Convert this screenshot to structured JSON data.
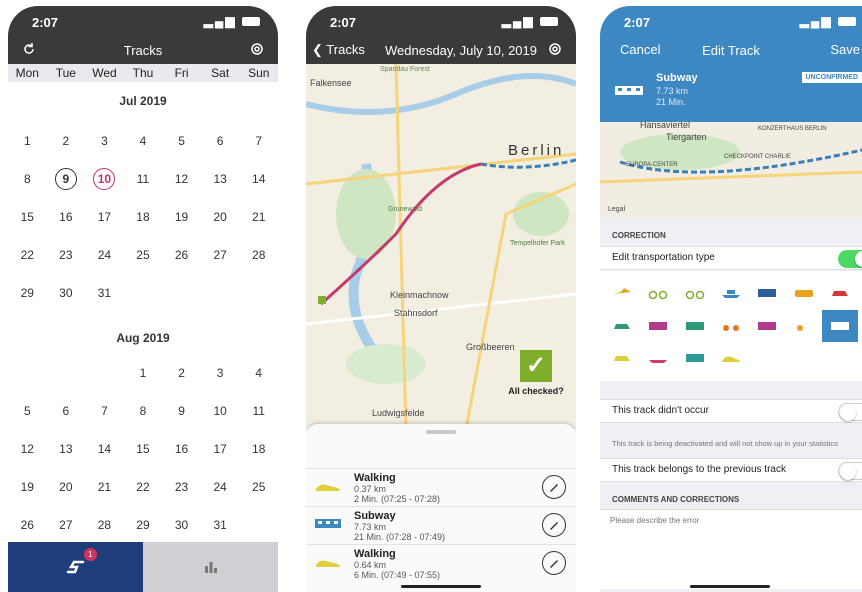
{
  "status": {
    "time": "2:07"
  },
  "screen1": {
    "title": "Tracks",
    "weekdays": [
      "Mon",
      "Tue",
      "Wed",
      "Thu",
      "Fri",
      "Sat",
      "Sun"
    ],
    "months": [
      {
        "label": "Jul 2019",
        "days": [
          "1",
          "2",
          "3",
          "4",
          "5",
          "6",
          "7",
          "8",
          "9",
          "10",
          "11",
          "12",
          "13",
          "14",
          "15",
          "16",
          "17",
          "18",
          "19",
          "20",
          "21",
          "22",
          "23",
          "24",
          "25",
          "26",
          "27",
          "28",
          "29",
          "30",
          "31"
        ],
        "offset": 0
      },
      {
        "label": "Aug 2019",
        "days": [
          "1",
          "2",
          "3",
          "4",
          "5",
          "6",
          "7",
          "8",
          "9",
          "10",
          "11",
          "12",
          "13",
          "14",
          "15",
          "16",
          "17",
          "18",
          "19",
          "20",
          "21",
          "22",
          "23",
          "24",
          "25",
          "26",
          "27",
          "28",
          "29",
          "30",
          "31"
        ],
        "offset": 3
      }
    ],
    "selected_day": "9",
    "today_day": "10",
    "badge": "1"
  },
  "screen2": {
    "back_label": "Tracks",
    "title": "Wednesday, July 10, 2019",
    "map_labels": {
      "falkensee": "Falkensee",
      "berlin": "Berlin",
      "tempelhof": "Tempelhofer Park",
      "grunewald": "Grunewald",
      "kleinmachnow": "Kleinmachnow",
      "stahnsdorf": "Stahnsdorf",
      "grossbeeren": "Großbeeren",
      "ludwigsfelde": "Ludwigsfelde",
      "spandau": "Spandau Forest"
    },
    "all_checked": "All checked?",
    "tracks": [
      {
        "mode": "Walking",
        "distance": "0.37 km",
        "duration": "2 Min. (07:25 - 07:28)"
      },
      {
        "mode": "Subway",
        "distance": "7.73 km",
        "duration": "21 Min. (07:28 - 07:49)"
      },
      {
        "mode": "Walking",
        "distance": "0.64 km",
        "duration": "6 Min. (07:49 - 07:55)"
      }
    ]
  },
  "screen3": {
    "cancel": "Cancel",
    "title": "Edit Track",
    "save": "Save",
    "track": {
      "mode": "Subway",
      "distance": "7.73 km",
      "duration": "21 Min."
    },
    "unconfirmed": "UNCONFIRMED",
    "map_labels": {
      "tiergarten": "Tiergarten",
      "hansaviertel": "Hansaviertel",
      "europa": "EUROPA-CENTER",
      "checkpoint": "CHECKPOINT CHARLIE",
      "konzert": "KONZERTHAUS BERLIN",
      "legal": "Legal"
    },
    "correction_header": "CORRECTION",
    "edit_type_label": "Edit transportation type",
    "didnt_occur": "This track didn't occur",
    "deactivated_note": "This track is being deactivated and will not show up in your statistics",
    "belongs_previous": "This track belongs to the previous track",
    "comments_header": "COMMENTS AND CORRECTIONS",
    "comments_placeholder": "Please describe the error"
  }
}
